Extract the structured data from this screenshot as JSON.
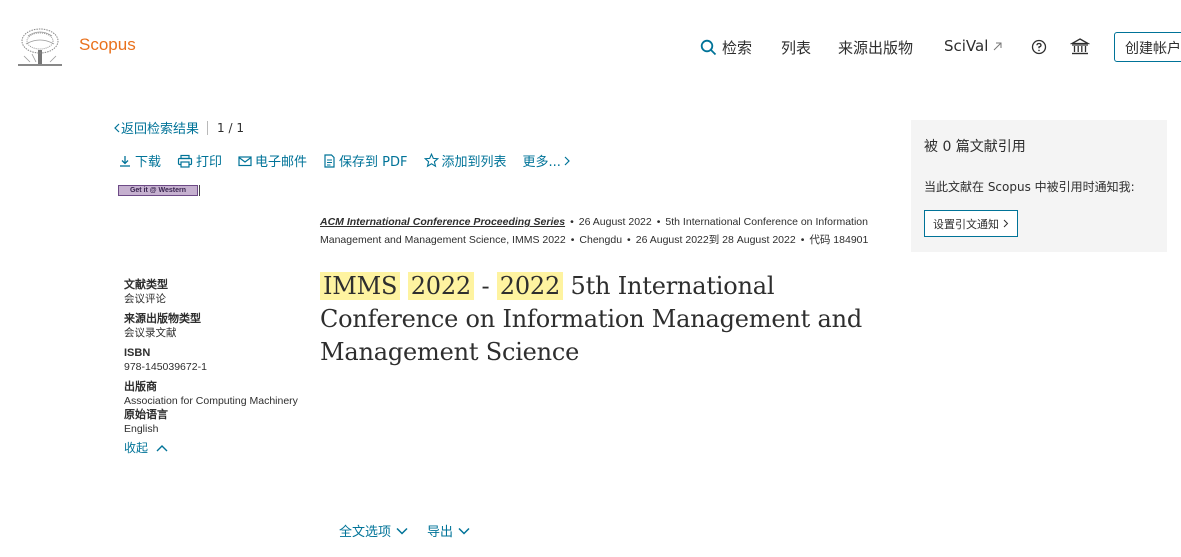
{
  "header": {
    "brand": "Scopus",
    "nav": {
      "search": "检索",
      "lists": "列表",
      "sources": "来源出版物",
      "scival": "SciVal"
    },
    "create_account": "创建帐户"
  },
  "navigation": {
    "back_label": "返回检索结果",
    "pager": "1 / 1"
  },
  "actions": {
    "download": "下载",
    "print": "打印",
    "email": "电子邮件",
    "save_pdf": "保存到 PDF",
    "add_to_list": "添加到列表",
    "more": "更多..."
  },
  "badge_label": "Get it @ Western",
  "source": {
    "series": "ACM International Conference Proceeding Series",
    "date": "26 August 2022",
    "conference": "5th International Conference on Information Management and Management Science, IMMS 2022",
    "location": "Chengdu",
    "date_range": "26 August 2022到 28 August 2022",
    "code": "代码 184901"
  },
  "title": {
    "part1": "IMMS",
    "part2": "2022",
    "dash": "-",
    "part3": "2022",
    "rest": "5th International Conference on Information Management and Management Science"
  },
  "metadata": {
    "doc_type_label": "文献类型",
    "doc_type_value": "会议评论",
    "source_type_label": "来源出版物类型",
    "source_type_value": "会议录文献",
    "isbn_label": "ISBN",
    "isbn_value": "978-145039672-1",
    "publisher_label": "出版商",
    "publisher_value": "Association for Computing Machinery",
    "language_label": "原始语言",
    "language_value": "English",
    "collapse_label": "收起"
  },
  "bottom": {
    "full_text": "全文选项",
    "export": "导出"
  },
  "cited_panel": {
    "title": "被 0 篇文献引用",
    "description": "当此文献在 Scopus 中被引用时通知我:",
    "alert_button": "设置引文通知"
  },
  "colors": {
    "accent": "#007398",
    "brand": "#e9711c",
    "highlight": "#fef3a0",
    "panel_bg": "#f4f4f4"
  }
}
